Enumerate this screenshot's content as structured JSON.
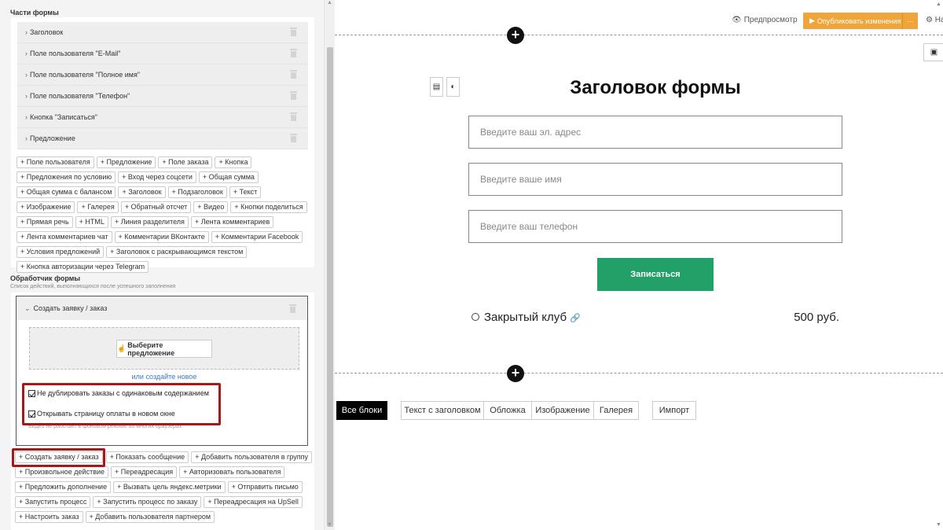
{
  "form_parts": {
    "title": "Части формы",
    "items": [
      {
        "label": "Заголовок"
      },
      {
        "label": "Поле пользователя \"E-Mail\""
      },
      {
        "label": "Поле пользователя \"Полное имя\""
      },
      {
        "label": "Поле пользователя \"Телефон\""
      },
      {
        "label": "Кнопка \"Записаться\""
      },
      {
        "label": "Предложение"
      }
    ],
    "add_buttons": [
      "+ Поле пользователя",
      "+ Предложение",
      "+ Поле заказа",
      "+ Кнопка",
      "+ Предложения по условию",
      "+ Вход через соцсети",
      "+ Общая сумма",
      "+ Общая сумма с балансом",
      "+ Заголовок",
      "+ Подзаголовок",
      "+ Текст",
      "+ Изображение",
      "+ Галерея",
      "+ Обратный отсчет",
      "+ Видео",
      "+ Кнопки поделиться",
      "+ Прямая речь",
      "+ HTML",
      "+ Линия разделителя",
      "+ Лента комментариев",
      "+ Лента комментариев чат",
      "+ Комментарии ВКонтакте",
      "+ Комментарии Facebook",
      "+ Условия предложений",
      "+ Заголовок с раскрывающимся текстом",
      "+ Кнопка авторизации через Telegram"
    ]
  },
  "handler": {
    "title": "Обработчик формы",
    "subtitle": "Список действий, выполняющихся после успешного заполнения",
    "action_title": "Создать заявку / заказ",
    "select_offer": "Выберите предложение",
    "create_new": "или создайте новое",
    "checkbox1": "Не дублировать заказы с одинаковым содержанием",
    "checkbox2": "Открывать страницу оплаты в новом окне",
    "note": "Видео не работает в фоновом режиме во многих браузерах",
    "highlighted_button": "+ Создать заявку / заказ",
    "add_buttons": [
      "+ Показать сообщение",
      "+ Добавить пользователя в группу",
      "+ Произвольное действие",
      "+ Переадресация",
      "+ Авторизовать пользователя",
      "+ Предложить дополнение",
      "+ Вызвать цель яндекс.метрики",
      "+ Отправить письмо",
      "+ Запустить процесс",
      "+ Запустить процесс по заказу",
      "+ Переадресация на UpSell",
      "+ Настроить заказ",
      "+ Добавить пользователя партнером"
    ]
  },
  "toolbar": {
    "preview": "Предпросмотр",
    "publish": "Опубликовать изменения",
    "settings": "На"
  },
  "form": {
    "title": "Заголовок формы",
    "email_placeholder": "Введите ваш эл. адрес",
    "name_placeholder": "Введите ваше имя",
    "phone_placeholder": "Введите ваш телефон",
    "submit": "Записаться",
    "offer_name": "Закрытый клуб",
    "offer_price": "500 руб."
  },
  "blocks": {
    "tabs": [
      "Все блоки",
      "Текст с заголовком",
      "Обложка",
      "Изображение",
      "Галерея"
    ],
    "import": "Импорт"
  },
  "colors": {
    "publish": "#f0a53a",
    "submit": "#21a067",
    "highlight": "#a51919",
    "link": "#3a78c3"
  }
}
